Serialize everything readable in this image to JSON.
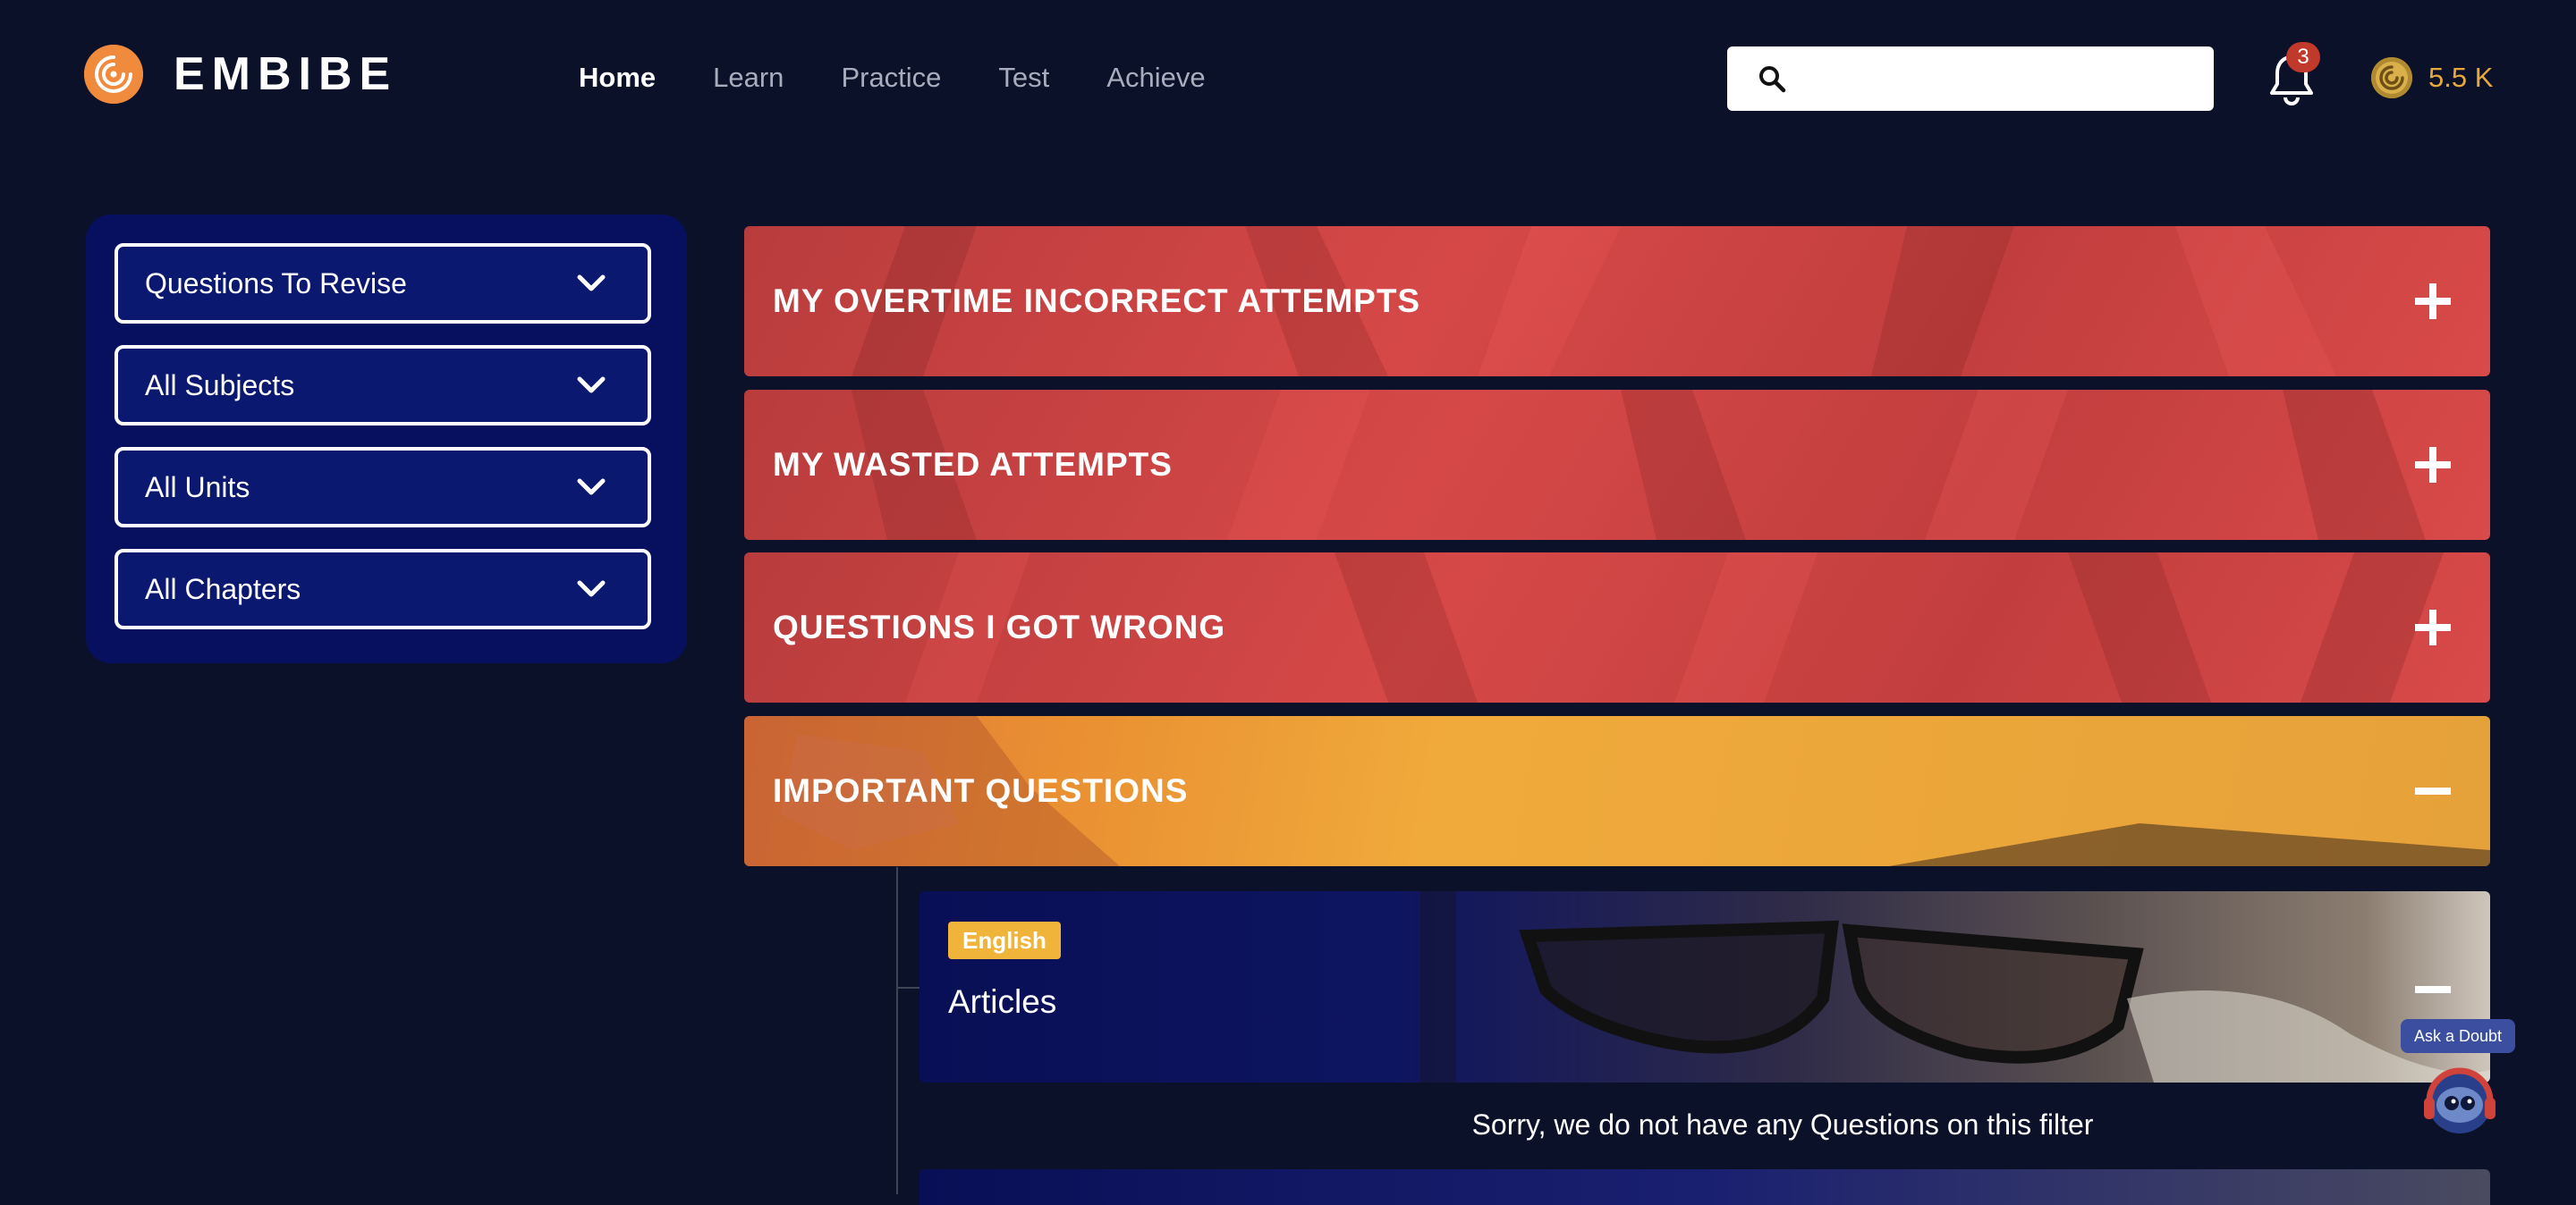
{
  "header": {
    "brand": "EMBIBE",
    "nav": [
      "Home",
      "Learn",
      "Practice",
      "Test",
      "Achieve"
    ],
    "active_nav": "Home",
    "search": {
      "placeholder": "",
      "value": ""
    },
    "notifications": {
      "count": "3",
      "icon": "bell-icon"
    },
    "coins": {
      "value": "5.5 K",
      "icon": "coin-icon"
    }
  },
  "filters": [
    {
      "label": "Questions To Revise"
    },
    {
      "label": "All Subjects"
    },
    {
      "label": "All Units"
    },
    {
      "label": "All Chapters"
    }
  ],
  "sections": [
    {
      "title": "MY OVERTIME INCORRECT ATTEMPTS",
      "state": "collapsed",
      "color": "#d64848"
    },
    {
      "title": "MY WASTED ATTEMPTS",
      "state": "collapsed",
      "color": "#d64848"
    },
    {
      "title": "QUESTIONS I GOT WRONG",
      "state": "collapsed",
      "color": "#d64848"
    },
    {
      "title": "IMPORTANT QUESTIONS",
      "state": "expanded",
      "color": "#f0aa3b"
    }
  ],
  "subject_card": {
    "tag": "English",
    "title": "Articles",
    "state": "expanded",
    "empty_message": "Sorry, we do not have any Questions on this filter"
  },
  "ask_doubt": {
    "label": "Ask a Doubt"
  },
  "colors": {
    "background": "#0a1128",
    "panel": "#07105e",
    "accent": "#f0aa3b",
    "coins": "#e8a93c"
  }
}
